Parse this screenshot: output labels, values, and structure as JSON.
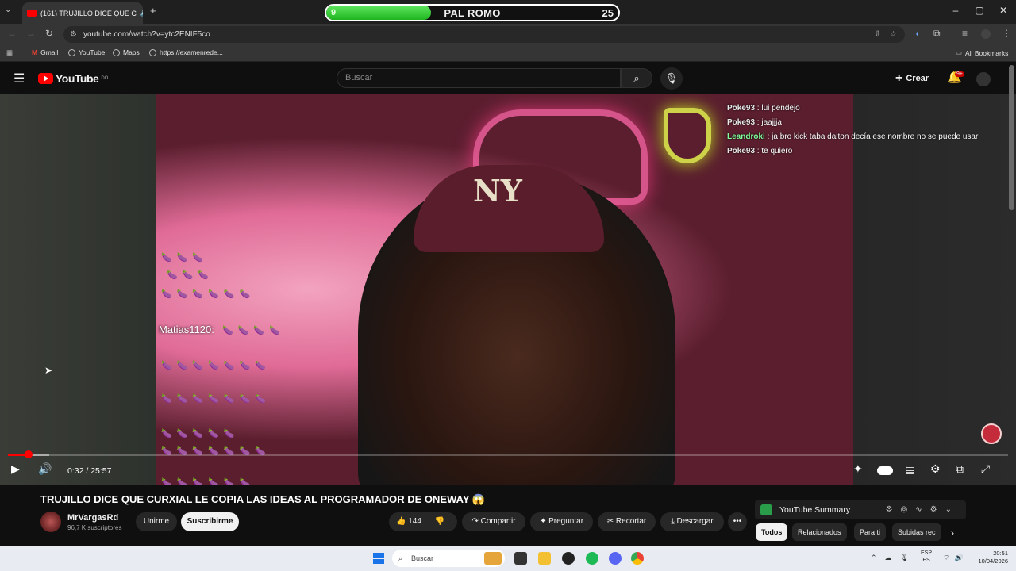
{
  "browser": {
    "tab_title": "(161) TRUJILLO DICE QUE C",
    "url": "youtube.com/watch?v=ytc2ENIF5co",
    "bookmarks": [
      "Gmail",
      "YouTube",
      "Maps",
      "https://examenrede..."
    ],
    "all_bookmarks": "All Bookmarks"
  },
  "overlay_poll": {
    "left_value": "9",
    "title": "PAL ROMO",
    "right_value": "25",
    "left_share": 0.36
  },
  "youtube": {
    "logo_text": "YouTube",
    "country_code": "DO",
    "search_placeholder": "Buscar",
    "create_label": "Crear",
    "notification_count": "9+"
  },
  "stream_chat": [
    {
      "user": "Poke93",
      "text": "lui pendejo",
      "color": "#e8e8e8"
    },
    {
      "user": "Poke93",
      "text": "jaajjja",
      "color": "#e8e8e8"
    },
    {
      "user": "Leandroki",
      "text": "ja bro kick taba dalton decía ese nombre no se puede usar",
      "color": "#7dff9a"
    },
    {
      "user": "Poke93",
      "text": "te quiero",
      "color": "#e8e8e8"
    }
  ],
  "donor_label": "Matias1120:",
  "player": {
    "time_display": "0:32 / 25:57",
    "played_fraction": 0.021,
    "buffered_fraction": 0.041
  },
  "video": {
    "title": "TRUJILLO DICE QUE CURXIAL LE COPIA LAS IDEAS AL PROGRAMADOR DE ONEWAY 😱",
    "channel": "MrVargasRd",
    "subscribers": "96,7 K suscriptores",
    "join_label": "Unirme",
    "subscribe_label": "Suscribirme",
    "like_count": "144",
    "share_label": "Compartir",
    "ask_label": "Preguntar",
    "clip_label": "Recortar",
    "download_label": "Descargar"
  },
  "sidebar": {
    "summary_label": "YouTube Summary",
    "chips": [
      "Todos",
      "Relacionados",
      "Para ti",
      "Subidas rec"
    ]
  },
  "taskbar": {
    "search_placeholder": "Buscar",
    "lang_top": "ESP",
    "lang_bottom": "ES",
    "time": "20:51",
    "date": "10/04/2026"
  }
}
